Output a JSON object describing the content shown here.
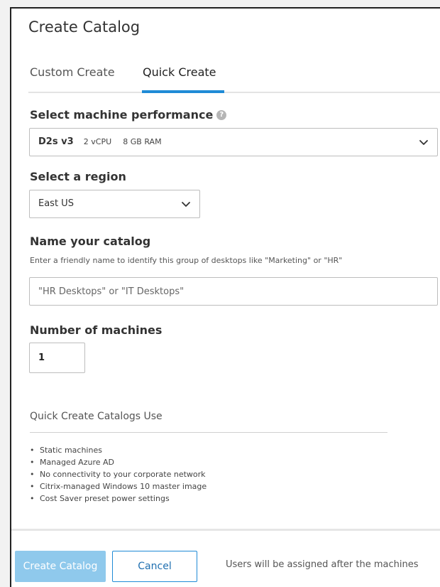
{
  "dialog": {
    "title": "Create Catalog"
  },
  "tabs": [
    {
      "label": "Custom Create",
      "active": false
    },
    {
      "label": "Quick Create",
      "active": true
    }
  ],
  "performance": {
    "label": "Select machine performance",
    "help_icon": "question-circle-icon",
    "selected": {
      "name": "D2s v3",
      "cpu": "2 vCPU",
      "ram": "8 GB RAM"
    }
  },
  "region": {
    "label": "Select a region",
    "selected": "East US"
  },
  "catalog_name": {
    "label": "Name your catalog",
    "hint": "Enter a friendly name to identify this group of desktops like \"Marketing\" or \"HR\"",
    "value": "",
    "placeholder": "\"HR Desktops\" or \"IT Desktops\""
  },
  "machines": {
    "label": "Number of machines",
    "value": "1"
  },
  "info": {
    "title": "Quick Create Catalogs Use",
    "items": [
      "Static machines",
      "Managed Azure AD",
      "No connectivity to your corporate network",
      "Citrix-managed Windows 10 master image",
      "Cost Saver preset power settings"
    ]
  },
  "footer": {
    "create_label": "Create Catalog",
    "cancel_label": "Cancel",
    "note": "Users will be assigned after the machines"
  },
  "colors": {
    "accent": "#1f8bd6",
    "primary_disabled": "#8fc9ec"
  }
}
